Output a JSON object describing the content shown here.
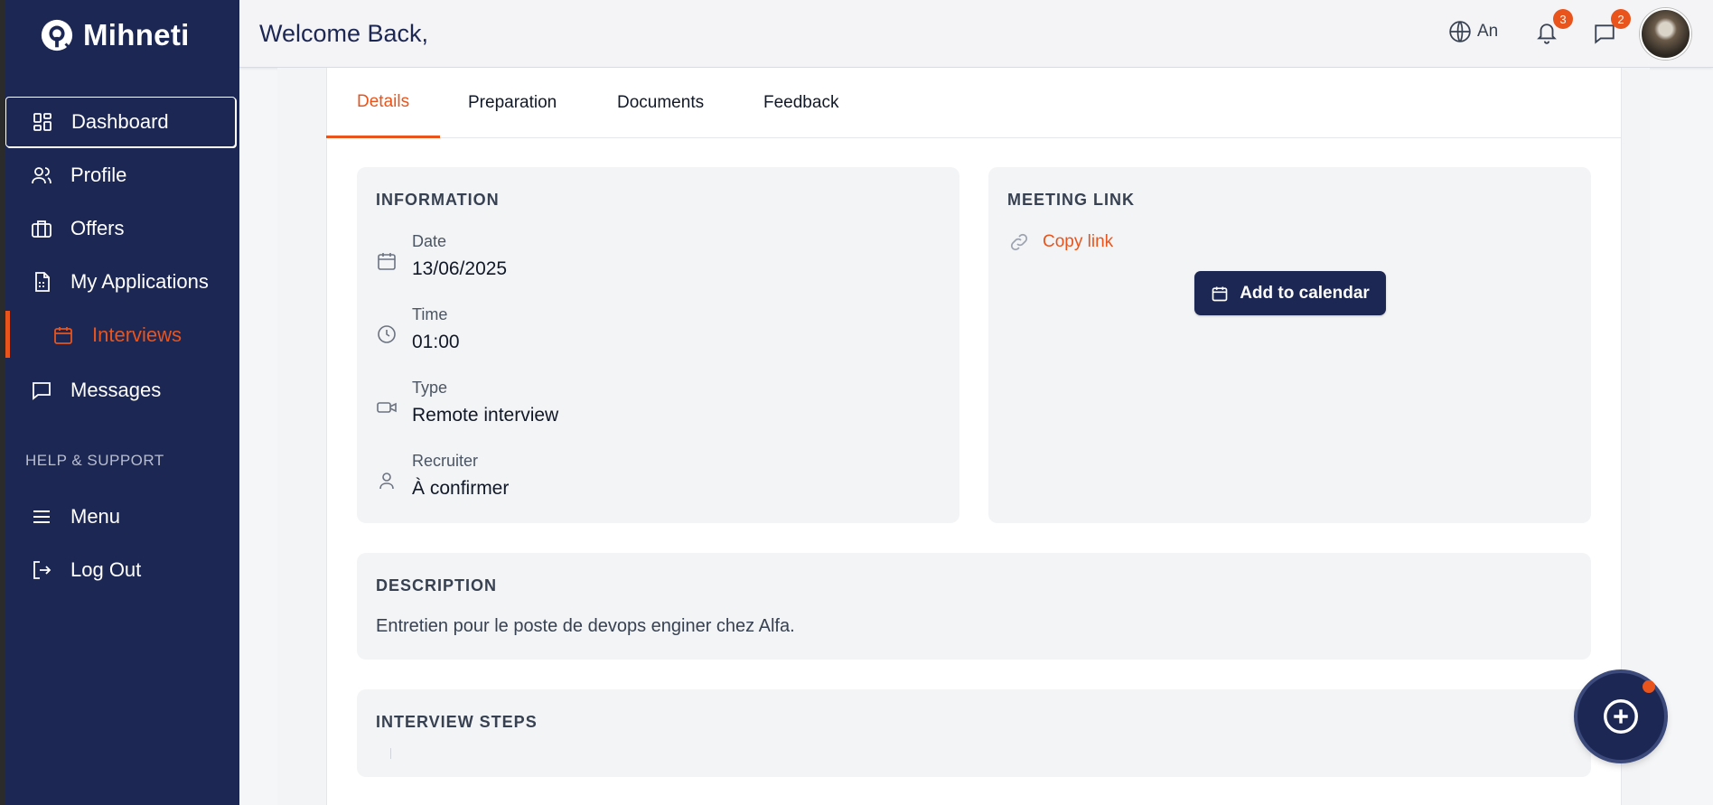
{
  "brand": {
    "name": "Mihneti"
  },
  "sidebar": {
    "items": [
      {
        "label": "Dashboard",
        "icon": "dashboard-icon"
      },
      {
        "label": "Profile",
        "icon": "users-icon"
      },
      {
        "label": "Offers",
        "icon": "briefcase-icon"
      },
      {
        "label": "My Applications",
        "icon": "file-icon"
      },
      {
        "label": "Interviews",
        "icon": "calendar-icon"
      },
      {
        "label": "Messages",
        "icon": "message-icon"
      }
    ],
    "help_label": "HELP & SUPPORT",
    "help_items": [
      {
        "label": "Menu",
        "icon": "menu-icon"
      },
      {
        "label": "Log Out",
        "icon": "logout-icon"
      }
    ]
  },
  "header": {
    "welcome": "Welcome Back,",
    "language": "An",
    "notifications_count": "3",
    "messages_count": "2"
  },
  "tabs": [
    "Details",
    "Preparation",
    "Documents",
    "Feedback"
  ],
  "information": {
    "title": "INFORMATION",
    "date_label": "Date",
    "date_value": "13/06/2025",
    "time_label": "Time",
    "time_value": "01:00",
    "type_label": "Type",
    "type_value": "Remote interview",
    "recruiter_label": "Recruiter",
    "recruiter_value": "À confirmer"
  },
  "meeting": {
    "title": "MEETING LINK",
    "copy_label": "Copy link",
    "calendar_label": "Add to calendar"
  },
  "description": {
    "title": "DESCRIPTION",
    "text": "Entretien pour le poste de devops enginer chez Alfa."
  },
  "steps": {
    "title": "INTERVIEW STEPS"
  },
  "colors": {
    "accent": "#e8541c",
    "navy": "#1c2754"
  }
}
